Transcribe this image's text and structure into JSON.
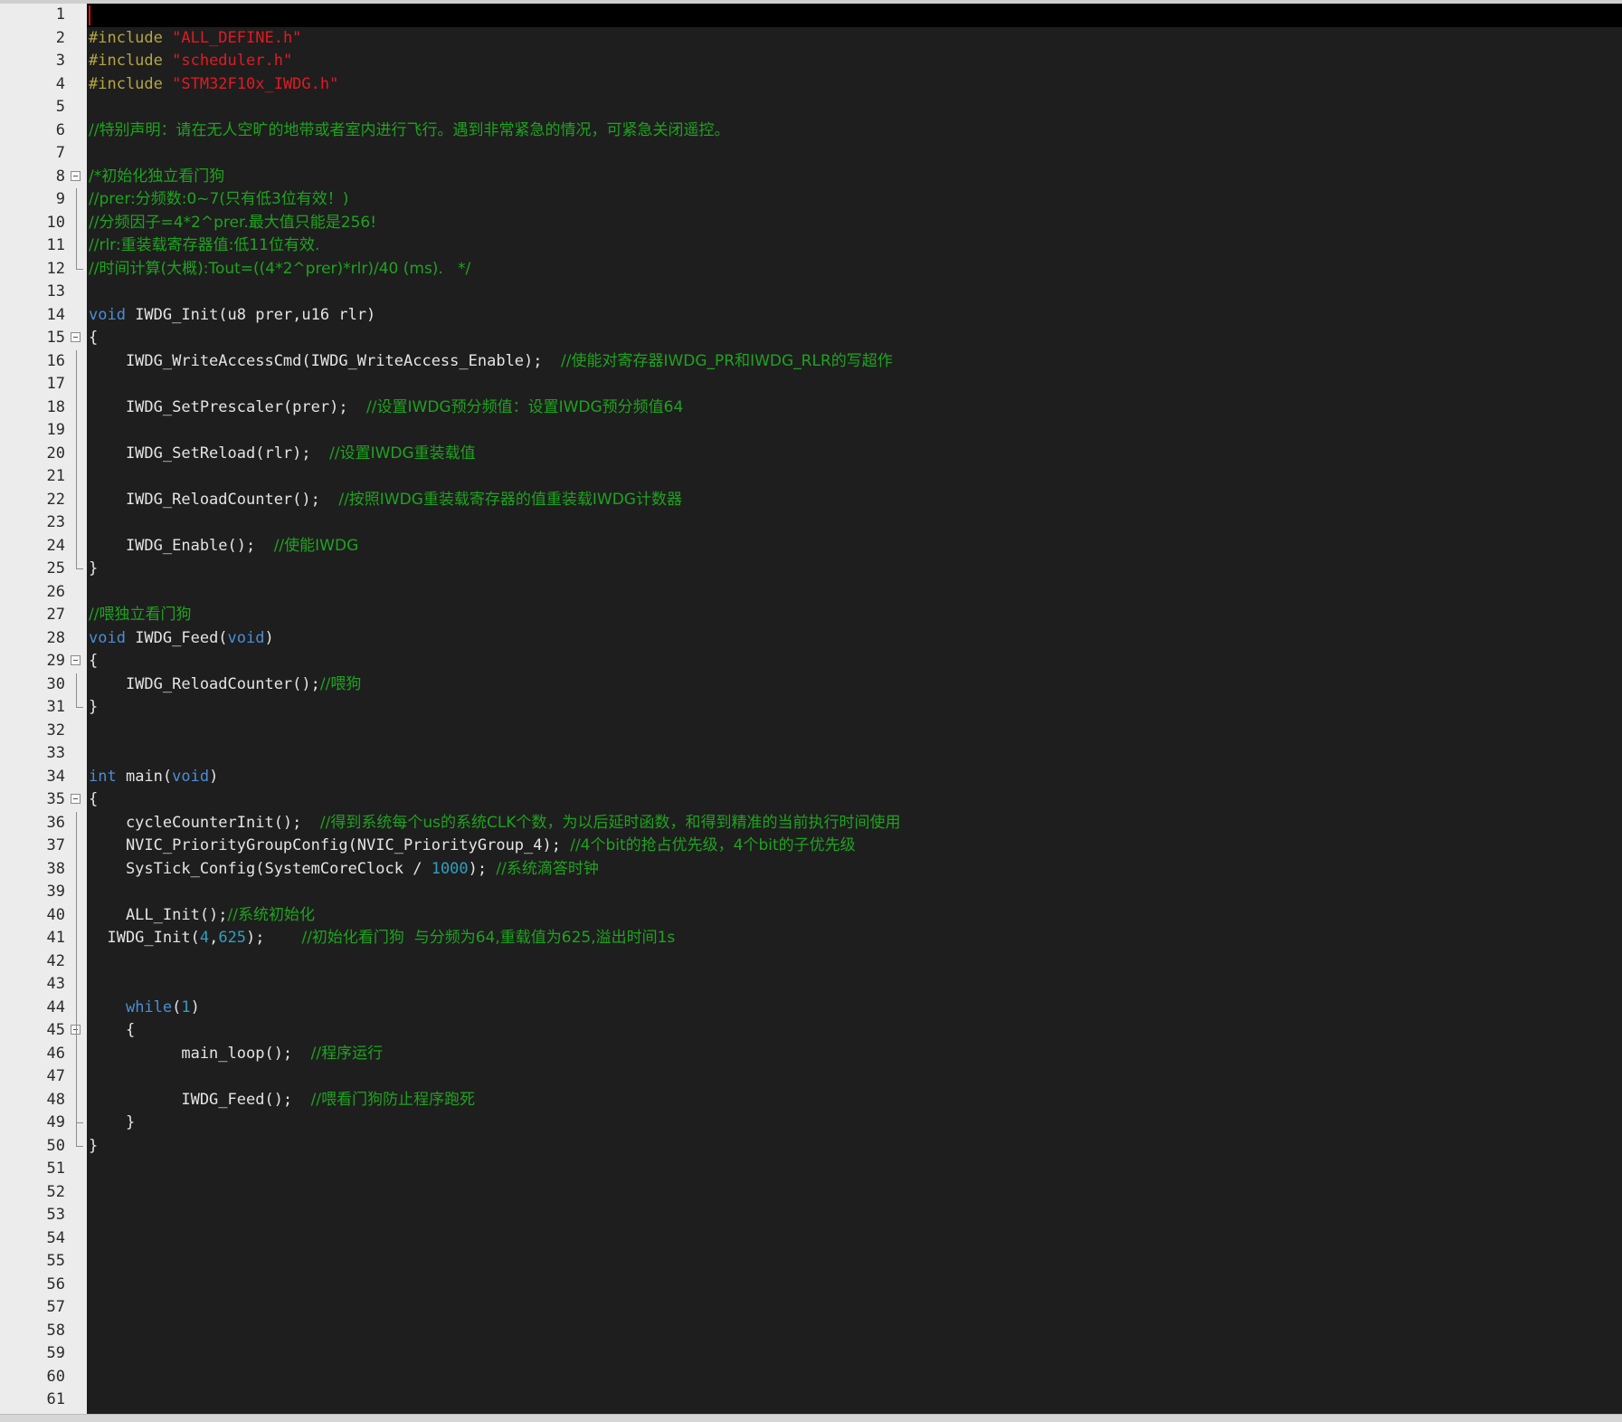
{
  "editor": {
    "colors": {
      "background": "#1e1e1e",
      "current_line": "#000000",
      "preprocessor": "#b5a642",
      "string": "#e01b24",
      "comment": "#1ea31e",
      "keyword": "#4a8ed6",
      "number": "#2f9fc0",
      "text": "#e4e4e4",
      "gutter": "#ececec"
    },
    "current_line": 1,
    "fold_markers": [
      8,
      15,
      29,
      35,
      45
    ],
    "lines": [
      [],
      [
        {
          "t": "pre",
          "v": "#include "
        },
        {
          "t": "str",
          "v": "\"ALL_DEFINE.h\""
        }
      ],
      [
        {
          "t": "pre",
          "v": "#include "
        },
        {
          "t": "str",
          "v": "\"scheduler.h\""
        }
      ],
      [
        {
          "t": "pre",
          "v": "#include "
        },
        {
          "t": "str",
          "v": "\"STM32F10x_IWDG.h\""
        }
      ],
      [],
      [
        {
          "t": "cmt",
          "v": "//特别声明：请在无人空旷的地带或者室内进行飞行。遇到非常紧急的情况，可紧急关闭遥控。"
        }
      ],
      [],
      [
        {
          "t": "cmt",
          "v": "/*初始化独立看门狗"
        }
      ],
      [
        {
          "t": "cmt",
          "v": "//prer:分频数:0~7(只有低3位有效！)"
        }
      ],
      [
        {
          "t": "cmt",
          "v": "//分频因子=4*2^prer.最大值只能是256!"
        }
      ],
      [
        {
          "t": "cmt",
          "v": "//rlr:重装载寄存器值:低11位有效."
        }
      ],
      [
        {
          "t": "cmt",
          "v": "//时间计算(大概):Tout=((4*2^prer)*rlr)/40 (ms).   */"
        }
      ],
      [],
      [
        {
          "t": "kw",
          "v": "void"
        },
        {
          "t": "plain",
          "v": " IWDG_Init(u8 prer,u16 rlr)"
        }
      ],
      [
        {
          "t": "plain",
          "v": "{"
        }
      ],
      [
        {
          "t": "plain",
          "v": "    IWDG_WriteAccessCmd(IWDG_WriteAccess_Enable);  "
        },
        {
          "t": "cmt",
          "v": "//使能对寄存器IWDG_PR和IWDG_RLR的写超作"
        }
      ],
      [],
      [
        {
          "t": "plain",
          "v": "    IWDG_SetPrescaler(prer);  "
        },
        {
          "t": "cmt",
          "v": "//设置IWDG预分频值：设置IWDG预分频值64"
        }
      ],
      [],
      [
        {
          "t": "plain",
          "v": "    IWDG_SetReload(rlr);  "
        },
        {
          "t": "cmt",
          "v": "//设置IWDG重装载值"
        }
      ],
      [],
      [
        {
          "t": "plain",
          "v": "    IWDG_ReloadCounter();  "
        },
        {
          "t": "cmt",
          "v": "//按照IWDG重装载寄存器的值重装载IWDG计数器"
        }
      ],
      [],
      [
        {
          "t": "plain",
          "v": "    IWDG_Enable();  "
        },
        {
          "t": "cmt",
          "v": "//使能IWDG"
        }
      ],
      [
        {
          "t": "plain",
          "v": "}"
        }
      ],
      [],
      [
        {
          "t": "cmt",
          "v": "//喂独立看门狗"
        }
      ],
      [
        {
          "t": "kw",
          "v": "void"
        },
        {
          "t": "plain",
          "v": " IWDG_Feed("
        },
        {
          "t": "kw",
          "v": "void"
        },
        {
          "t": "plain",
          "v": ")"
        }
      ],
      [
        {
          "t": "plain",
          "v": "{"
        }
      ],
      [
        {
          "t": "plain",
          "v": "    IWDG_ReloadCounter();"
        },
        {
          "t": "cmt",
          "v": "//喂狗"
        }
      ],
      [
        {
          "t": "plain",
          "v": "}"
        }
      ],
      [],
      [],
      [
        {
          "t": "kw",
          "v": "int"
        },
        {
          "t": "plain",
          "v": " main("
        },
        {
          "t": "kw",
          "v": "void"
        },
        {
          "t": "plain",
          "v": ")"
        }
      ],
      [
        {
          "t": "plain",
          "v": "{"
        }
      ],
      [
        {
          "t": "plain",
          "v": "    cycleCounterInit();  "
        },
        {
          "t": "cmt",
          "v": "//得到系统每个us的系统CLK个数，为以后延时函数，和得到精准的当前执行时间使用"
        }
      ],
      [
        {
          "t": "plain",
          "v": "    NVIC_PriorityGroupConfig(NVIC_PriorityGroup_4); "
        },
        {
          "t": "cmt",
          "v": "//4个bit的抢占优先级，4个bit的子优先级"
        }
      ],
      [
        {
          "t": "plain",
          "v": "    SysTick_Config(SystemCoreClock / "
        },
        {
          "t": "num",
          "v": "1000"
        },
        {
          "t": "plain",
          "v": "); "
        },
        {
          "t": "cmt",
          "v": "//系统滴答时钟"
        }
      ],
      [],
      [
        {
          "t": "plain",
          "v": "    ALL_Init();"
        },
        {
          "t": "cmt",
          "v": "//系统初始化"
        }
      ],
      [
        {
          "t": "plain",
          "v": "  IWDG_Init("
        },
        {
          "t": "num",
          "v": "4"
        },
        {
          "t": "plain",
          "v": ","
        },
        {
          "t": "num",
          "v": "625"
        },
        {
          "t": "plain",
          "v": ");    "
        },
        {
          "t": "cmt",
          "v": "//初始化看门狗  与分频为64,重载值为625,溢出时间1s"
        }
      ],
      [],
      [],
      [
        {
          "t": "plain",
          "v": "    "
        },
        {
          "t": "kw",
          "v": "while"
        },
        {
          "t": "plain",
          "v": "("
        },
        {
          "t": "num",
          "v": "1"
        },
        {
          "t": "plain",
          "v": ")"
        }
      ],
      [
        {
          "t": "plain",
          "v": "    {"
        }
      ],
      [
        {
          "t": "plain",
          "v": "          main_loop();  "
        },
        {
          "t": "cmt",
          "v": "//程序运行"
        }
      ],
      [],
      [
        {
          "t": "plain",
          "v": "          IWDG_Feed();  "
        },
        {
          "t": "cmt",
          "v": "//喂看门狗防止程序跑死"
        }
      ],
      [
        {
          "t": "plain",
          "v": "    }"
        }
      ],
      [
        {
          "t": "plain",
          "v": "}"
        }
      ],
      [],
      [],
      [],
      [],
      [],
      [],
      [],
      [],
      [],
      [],
      []
    ]
  }
}
